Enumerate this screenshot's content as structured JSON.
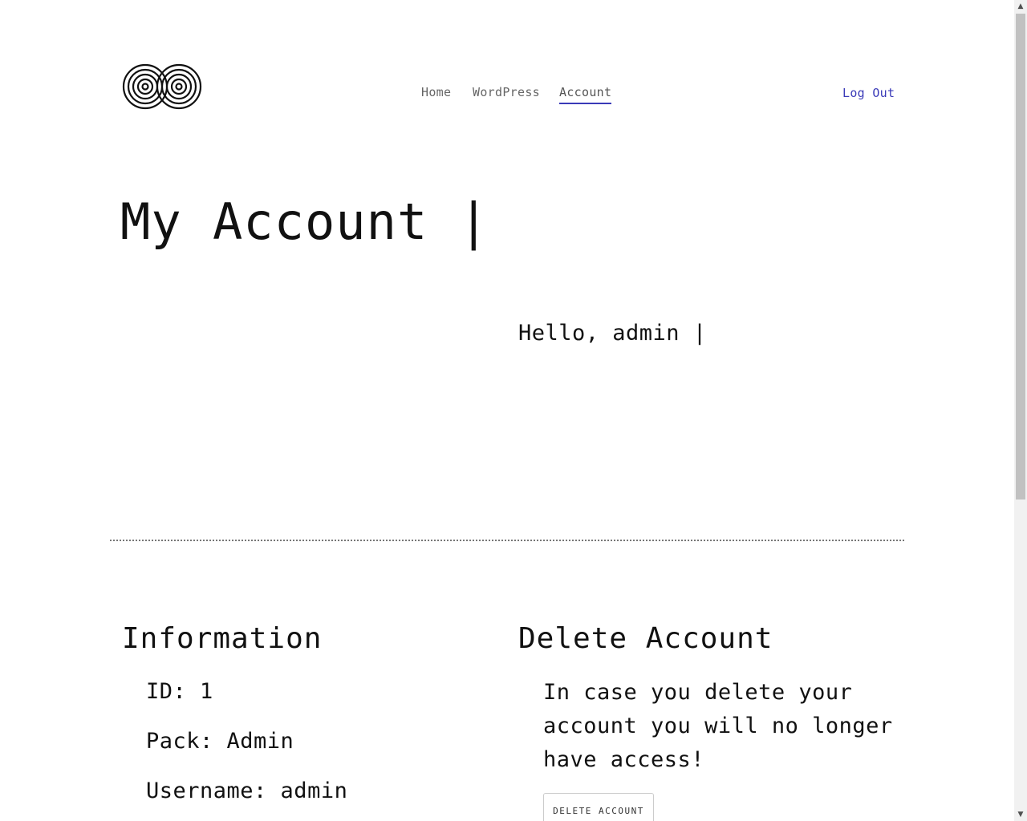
{
  "header": {
    "logo_icon": "infinity-spiral-logo-icon",
    "nav": [
      {
        "label": "Home"
      },
      {
        "label": "WordPress"
      },
      {
        "label": "Account"
      }
    ],
    "logout_label": "Log Out",
    "accent_color": "#3a3ab8"
  },
  "main": {
    "title": "My Account |",
    "greeting": "Hello, admin |"
  },
  "information": {
    "heading": "Information",
    "id_line": "ID: 1",
    "pack_line": "Pack: Admin",
    "username_line": "Username: admin"
  },
  "delete_account": {
    "heading": "Delete Account",
    "warning": "In case you delete your account you will no longer have access!",
    "button_label": "DELETE ACCOUNT"
  },
  "scrollbar": {
    "up_icon": "▲",
    "down_icon": "▼"
  }
}
